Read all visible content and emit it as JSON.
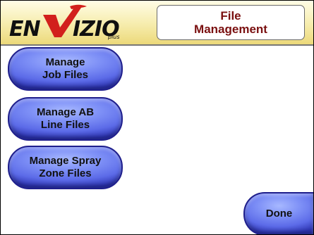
{
  "header": {
    "logo_text": "ENVIZIO",
    "logo_suffix": "plus",
    "title": "File\nManagement"
  },
  "buttons": {
    "manage_job_files": "Manage\nJob Files",
    "manage_ab_line_files": "Manage AB\nLine Files",
    "manage_spray_zone_files": "Manage Spray\nZone Files",
    "done": "Done"
  },
  "colors": {
    "title_text": "#7a1010",
    "logo_red": "#d2201c",
    "logo_black": "#101010",
    "button_blue": "#5c6be8",
    "button_border": "#1f1f8c",
    "header_gold": "#f6ecac"
  }
}
